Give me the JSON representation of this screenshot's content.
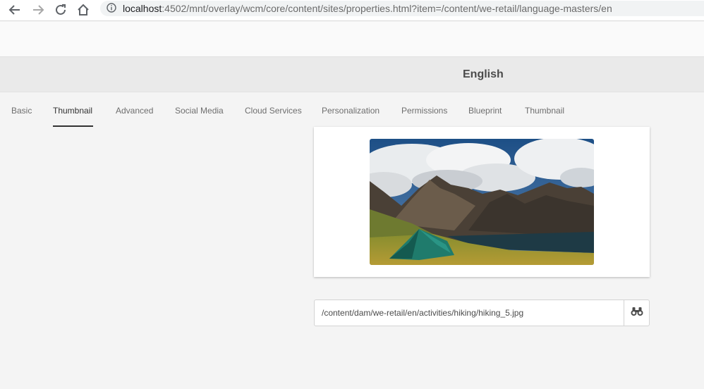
{
  "browser": {
    "url_host": "localhost",
    "url_rest": ":4502/mnt/overlay/wcm/core/content/sites/properties.html?item=/content/we-retail/language-masters/en",
    "icons": [
      "back-arrow-icon",
      "forward-arrow-icon",
      "reload-icon",
      "home-icon",
      "info-icon"
    ]
  },
  "header": {
    "page_title": "English"
  },
  "tabs": [
    {
      "label": "Basic",
      "active": false
    },
    {
      "label": "Thumbnail",
      "active": true
    },
    {
      "label": "Advanced",
      "active": false
    },
    {
      "label": "Social Media",
      "active": false
    },
    {
      "label": "Cloud Services",
      "active": false
    },
    {
      "label": "Personalization",
      "active": false
    },
    {
      "label": "Permissions",
      "active": false
    },
    {
      "label": "Blueprint",
      "active": false
    },
    {
      "label": "Thumbnail",
      "active": false
    }
  ],
  "thumbnail": {
    "path_value": "/content/dam/we-retail/en/activities/hiking/hiking_5.jpg",
    "browse_icon": "binoculars-icon"
  },
  "colors": {
    "accent_tab_underline": "#323232",
    "background": "#f4f4f4",
    "tent": "#1f7b6c"
  }
}
